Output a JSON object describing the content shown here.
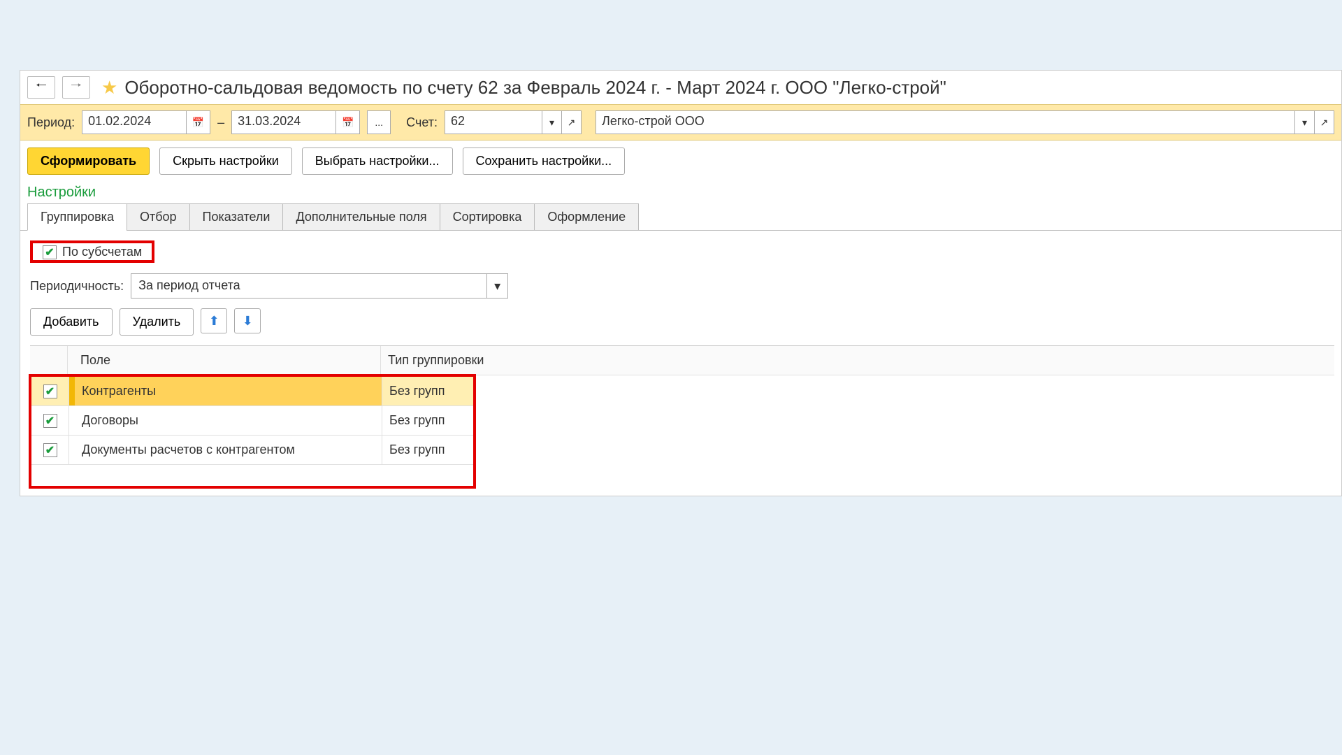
{
  "title": "Оборотно-сальдовая ведомость по счету 62 за Февраль 2024 г. - Март 2024 г. ООО \"Легко-строй\"",
  "period": {
    "label": "Период:",
    "from": "01.02.2024",
    "dash": "–",
    "to": "31.03.2024",
    "more": "..."
  },
  "account": {
    "label": "Счет:",
    "value": "62"
  },
  "org": {
    "value": "Легко-строй ООО"
  },
  "actions": {
    "generate": "Сформировать",
    "hide_settings": "Скрыть настройки",
    "choose_settings": "Выбрать настройки...",
    "save_settings": "Сохранить настройки..."
  },
  "settings_label": "Настройки",
  "tabs": {
    "grouping": "Группировка",
    "filter": "Отбор",
    "indicators": "Показатели",
    "extra_fields": "Дополнительные поля",
    "sorting": "Сортировка",
    "formatting": "Оформление"
  },
  "grouping": {
    "by_subaccounts": "По субсчетам",
    "periodicity_label": "Периодичность:",
    "periodicity_value": "За период отчета",
    "add": "Добавить",
    "delete": "Удалить",
    "col_field": "Поле",
    "col_type": "Тип группировки",
    "rows": [
      {
        "field": "Контрагенты",
        "type": "Без групп"
      },
      {
        "field": "Договоры",
        "type": "Без групп"
      },
      {
        "field": "Документы расчетов с контрагентом",
        "type": "Без групп"
      }
    ]
  }
}
